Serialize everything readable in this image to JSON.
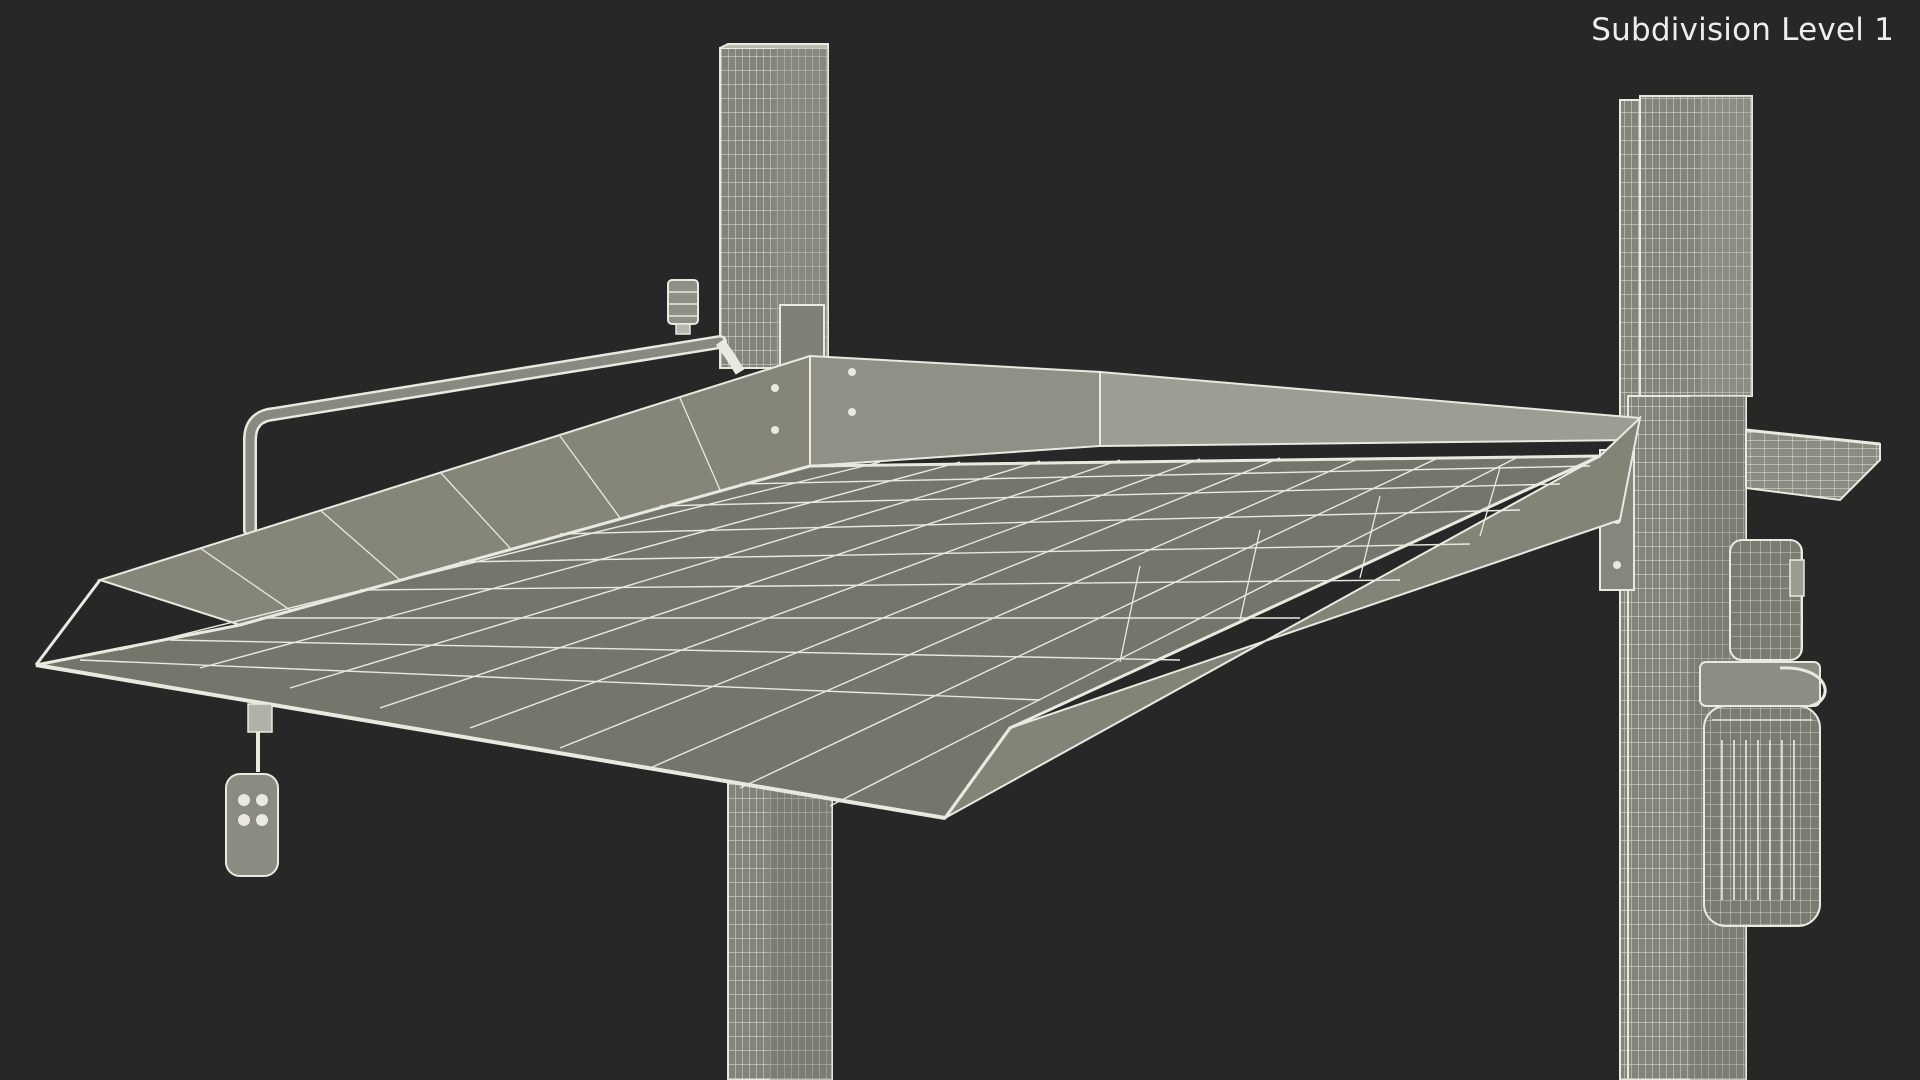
{
  "viewport": {
    "overlay_label": "Subdivision Level 1"
  },
  "colors": {
    "background": "#272727",
    "wire": "#e9e9df",
    "surface": "#75766b"
  }
}
